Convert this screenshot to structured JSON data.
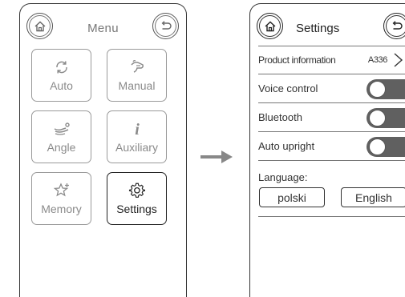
{
  "menu_screen": {
    "title": "Menu",
    "home_icon": "home-icon",
    "back_icon": "back-icon",
    "tiles": [
      {
        "label": "Auto",
        "icon": "refresh-icon",
        "active": false
      },
      {
        "label": "Manual",
        "icon": "hand-icon",
        "active": false
      },
      {
        "label": "Angle",
        "icon": "recline-icon",
        "active": false
      },
      {
        "label": "Auxiliary",
        "icon": "info-icon",
        "active": false
      },
      {
        "label": "Memory",
        "icon": "star-plus-icon",
        "active": false
      },
      {
        "label": "Settings",
        "icon": "gear-icon",
        "active": true
      }
    ]
  },
  "transition_icon": "arrow-right-icon",
  "settings_screen": {
    "title": "Settings",
    "home_icon": "home-icon",
    "back_icon": "back-icon",
    "product_info": {
      "label": "Product information",
      "model": "A336"
    },
    "toggles": [
      {
        "label": "Voice control",
        "on": false
      },
      {
        "label": "Bluetooth",
        "on": false
      },
      {
        "label": "Auto upright",
        "on": false
      }
    ],
    "language": {
      "label": "Language:",
      "options": [
        "polski",
        "English"
      ]
    }
  },
  "colors": {
    "outline": "#333333",
    "inactive": "#9a9a9a",
    "toggle_track": "#606060"
  }
}
